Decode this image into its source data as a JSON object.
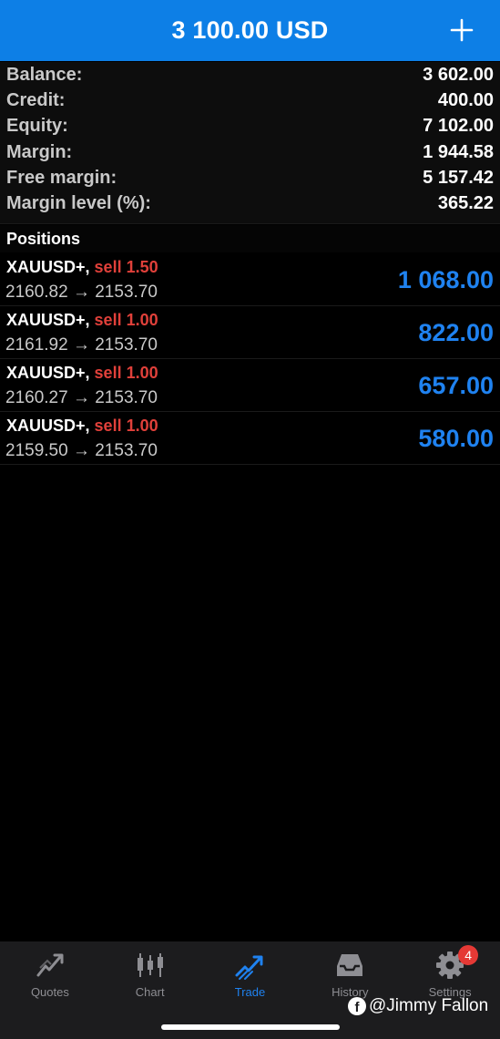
{
  "header": {
    "title": "3 100.00 USD",
    "add_icon": "plus-icon"
  },
  "account": {
    "rows": [
      {
        "label": "Balance:",
        "value": "3 602.00"
      },
      {
        "label": "Credit:",
        "value": "400.00"
      },
      {
        "label": "Equity:",
        "value": "7 102.00"
      },
      {
        "label": "Margin:",
        "value": "1 944.58"
      },
      {
        "label": "Free margin:",
        "value": "5 157.42"
      },
      {
        "label": "Margin level (%):",
        "value": "365.22"
      }
    ]
  },
  "positions": {
    "title": "Positions",
    "items": [
      {
        "symbol": "XAUUSD+,",
        "side": "sell 1.50",
        "prices": "2160.82 → 2153.70",
        "profit": "1 068.00"
      },
      {
        "symbol": "XAUUSD+,",
        "side": "sell 1.00",
        "prices": "2161.92 → 2153.70",
        "profit": "822.00"
      },
      {
        "symbol": "XAUUSD+,",
        "side": "sell 1.00",
        "prices": "2160.27 → 2153.70",
        "profit": "657.00"
      },
      {
        "symbol": "XAUUSD+,",
        "side": "sell 1.00",
        "prices": "2159.50 → 2153.70",
        "profit": "580.00"
      }
    ]
  },
  "tabs": [
    {
      "label": "Quotes",
      "icon": "quotes-icon"
    },
    {
      "label": "Chart",
      "icon": "candlestick-chart-icon"
    },
    {
      "label": "Trade",
      "icon": "trade-icon",
      "active": true
    },
    {
      "label": "History",
      "icon": "inbox-icon"
    },
    {
      "label": "Settings",
      "icon": "gear-icon",
      "badge": "4"
    }
  ],
  "watermark": {
    "text": "@Jimmy Fallon",
    "icon": "facebook-icon"
  },
  "colors": {
    "header": "#0d7fe6",
    "profit": "#1f82f0",
    "sell": "#e0403a",
    "background": "#000000"
  }
}
